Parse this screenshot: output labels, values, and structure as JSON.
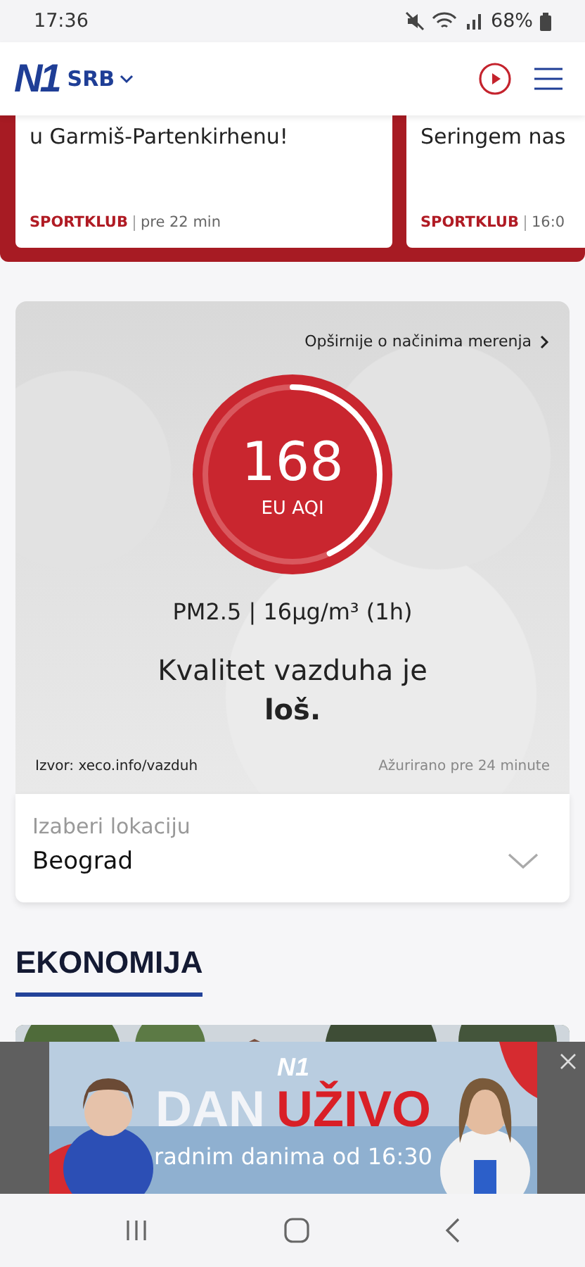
{
  "status_bar": {
    "time": "17:36",
    "battery": "68%"
  },
  "header": {
    "logo": "N1",
    "region": "SRB"
  },
  "top_cards": [
    {
      "headline": "u Garmiš-Partenkirhenu!",
      "source": "SPORTKLUB",
      "time": "pre 22 min"
    },
    {
      "headline": "Seringem nas",
      "source": "SPORTKLUB",
      "time": "16:0"
    }
  ],
  "air_quality": {
    "more_link": "Opširnije o načinima merenja",
    "value": "168",
    "index_label": "EU AQI",
    "level": 0.43,
    "pollutant": "PM2.5 | 16µg/m³ (1h)",
    "verdict": "Kvalitet vazduha je **loš.**",
    "source": "Izvor: xeco.info/vazduh",
    "updated": "Ažurirano pre 24 minute"
  },
  "location": {
    "label": "Izaberi lokaciju",
    "value": "Beograd"
  },
  "section": {
    "title": "EKONOMIJA"
  },
  "ad": {
    "logo": "N1",
    "title_left": "DAN",
    "title_right": "UŽIVO",
    "subtitle": "radnim danima od 16:30"
  }
}
